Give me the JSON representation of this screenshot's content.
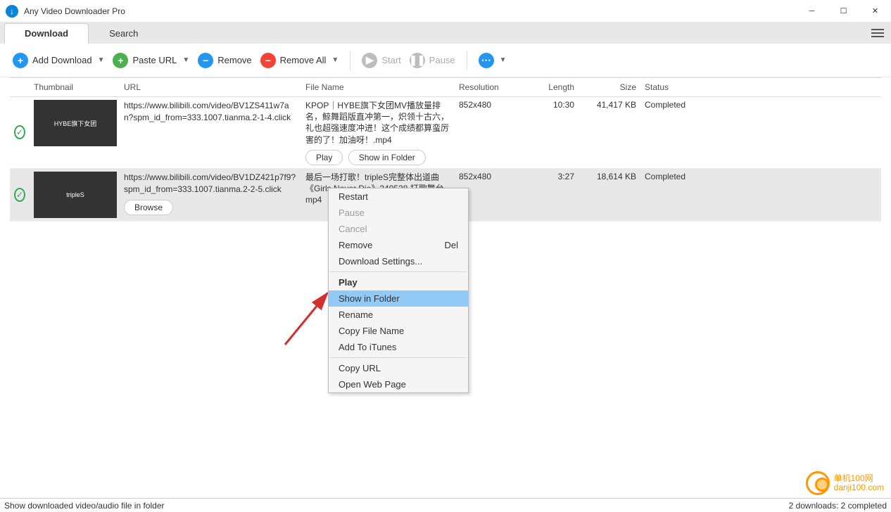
{
  "title": "Any Video Downloader Pro",
  "tabs": {
    "download": "Download",
    "search": "Search"
  },
  "toolbar": {
    "add": "Add Download",
    "paste": "Paste URL",
    "remove": "Remove",
    "removeAll": "Remove All",
    "start": "Start",
    "pause": "Pause"
  },
  "headers": {
    "thumbnail": "Thumbnail",
    "url": "URL",
    "filename": "File Name",
    "resolution": "Resolution",
    "length": "Length",
    "size": "Size",
    "status": "Status"
  },
  "rows": [
    {
      "thumb": "HYBE旗下女团",
      "url": "https://www.bilibili.com/video/BV1ZS411w7an?spm_id_from=333.1007.tianma.2-1-4.click",
      "filename": "KPOP｜HYBE旗下女团MV播放量排名，鲸舞蹈版直冲第一，炽领十古六，礼也超强速度冲进！这个成绩都算蛮厉害的了！加油呀！.mp4",
      "res": "852x480",
      "length": "10:30",
      "size": "41,417 KB",
      "status": "Completed",
      "btn1": "Play",
      "btn2": "Show in Folder"
    },
    {
      "thumb": "tripleS",
      "url": "https://www.bilibili.com/video/BV1DZ421p7f9?spm_id_from=333.1007.tianma.2-2-5.click",
      "filename": "最后一场打歌！tripleS完整体出道曲《Girls Never Die》240528 打歌舞台.mp4",
      "res": "852x480",
      "length": "3:27",
      "size": "18,614 KB",
      "status": "Completed",
      "btn1": "Browse"
    }
  ],
  "menu": {
    "restart": "Restart",
    "pause": "Pause",
    "cancel": "Cancel",
    "remove": "Remove",
    "del": "Del",
    "dlsettings": "Download Settings...",
    "play": "Play",
    "showfolder": "Show in Folder",
    "rename": "Rename",
    "copyname": "Copy File Name",
    "additunes": "Add To iTunes",
    "copyurl": "Copy URL",
    "openweb": "Open Web Page"
  },
  "status": {
    "left": "Show downloaded video/audio file in folder",
    "right": "2 downloads: 2 completed"
  },
  "watermark": {
    "line1": "单机100网",
    "line2": "danji100.com"
  }
}
